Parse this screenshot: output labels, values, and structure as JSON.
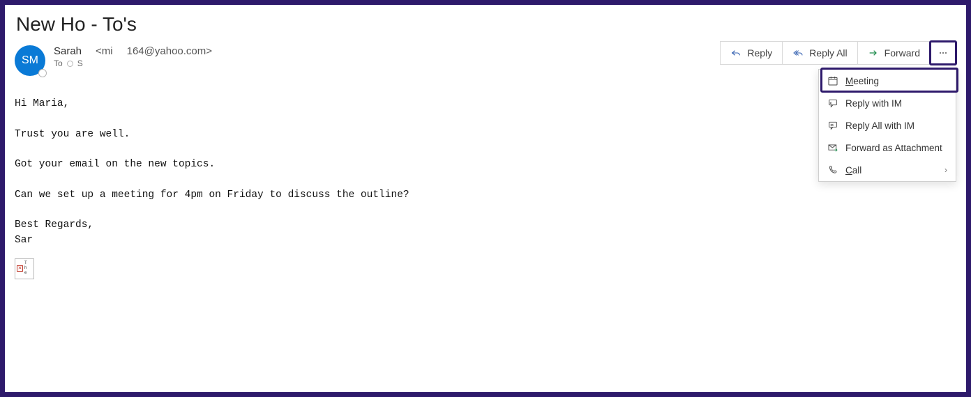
{
  "subject": "New Ho - To's",
  "sender": {
    "initials": "SM",
    "name": "Sarah",
    "email_prefix": "<mi",
    "email_suffix": "164@yahoo.com>"
  },
  "recipients": {
    "to_label": "To",
    "to_value": "S"
  },
  "body": "Hi Maria,\n\nTrust you are well.\n\nGot your email on the new topics.\n\nCan we set up a meeting for 4pm on Friday to discuss the outline?\n\nBest Regards,\nSar",
  "attachment": {
    "placeholder": "T\nh\ne"
  },
  "actions": {
    "reply": "Reply",
    "reply_all": "Reply All",
    "forward": "Forward"
  },
  "dropdown": {
    "meeting": "Meeting",
    "reply_im": "Reply with IM",
    "reply_all_im": "Reply All with IM",
    "forward_attach": "Forward as Attachment",
    "call": "Call"
  }
}
